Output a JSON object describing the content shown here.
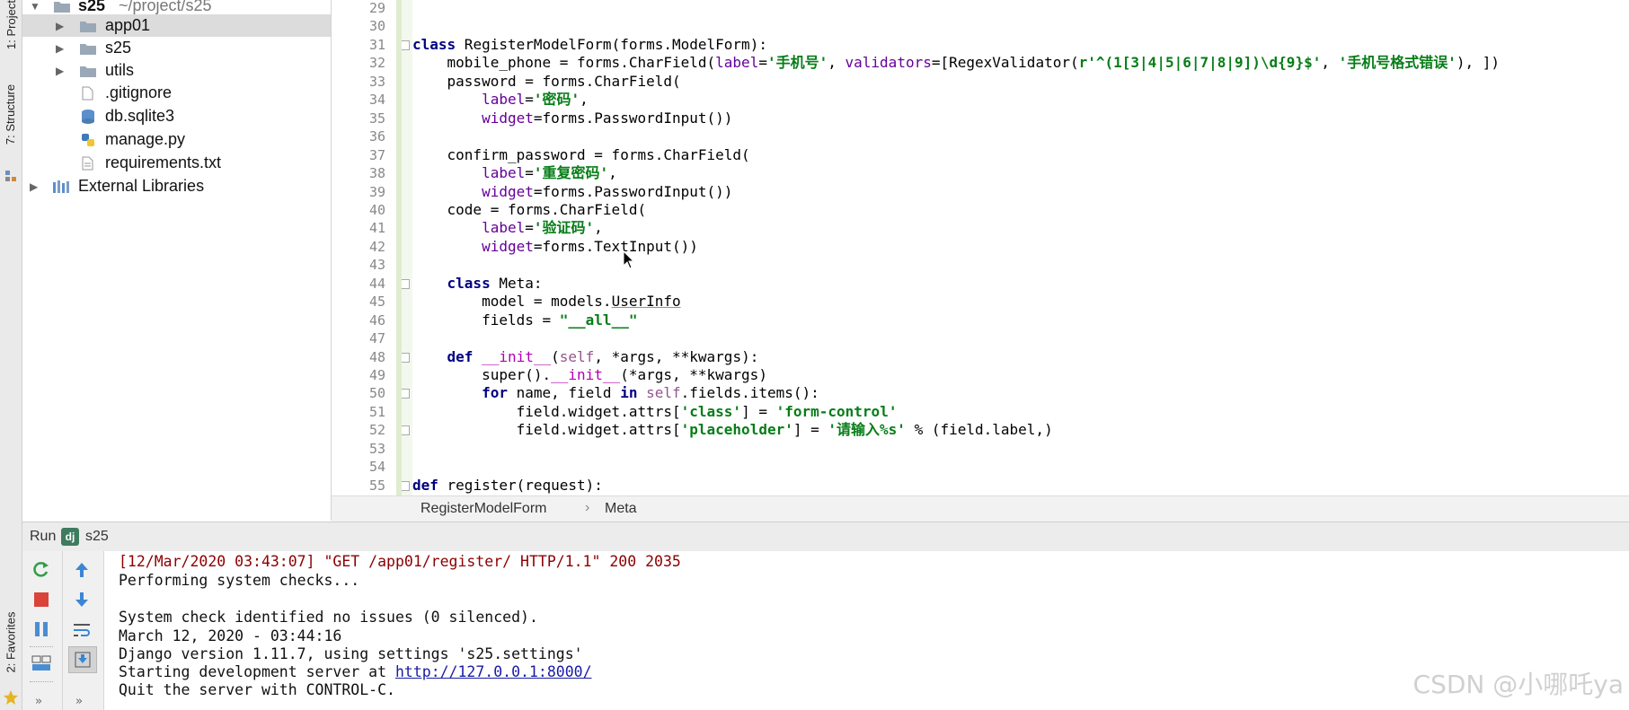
{
  "tool_windows": {
    "project_tab": "1: Project",
    "structure_tab": "7: Structure",
    "favorites_tab": "2: Favorites"
  },
  "project_tree": {
    "root_label": "s25",
    "root_path": "~/project/s25",
    "items": [
      {
        "label": "app01",
        "type": "folder",
        "selected": true
      },
      {
        "label": "s25",
        "type": "folder"
      },
      {
        "label": "utils",
        "type": "folder"
      },
      {
        "label": ".gitignore",
        "type": "file"
      },
      {
        "label": "db.sqlite3",
        "type": "database"
      },
      {
        "label": "manage.py",
        "type": "python"
      },
      {
        "label": "requirements.txt",
        "type": "text"
      },
      {
        "label": "External Libraries",
        "type": "libraries"
      }
    ]
  },
  "editor": {
    "line_numbers": [
      "29",
      "30",
      "31",
      "32",
      "33",
      "34",
      "35",
      "36",
      "37",
      "38",
      "39",
      "40",
      "41",
      "42",
      "43",
      "44",
      "45",
      "46",
      "47",
      "48",
      "49",
      "50",
      "51",
      "52",
      "53",
      "54",
      "55"
    ],
    "current_line": "45",
    "code_lines": [
      "",
      "",
      "class RegisterModelForm(forms.ModelForm):",
      "    mobile_phone = forms.CharField(label='手机号', validators=[RegexValidator(r'^(1[3|4|5|6|7|8|9])\\d{9}$', '手机号格式错误'), ])",
      "    password = forms.CharField(",
      "        label='密码',",
      "        widget=forms.PasswordInput())",
      "",
      "    confirm_password = forms.CharField(",
      "        label='重复密码',",
      "        widget=forms.PasswordInput())",
      "    code = forms.CharField(",
      "        label='验证码',",
      "        widget=forms.TextInput())",
      "",
      "    class Meta:",
      "        model = models.UserInfo",
      "        fields = \"__all__\"",
      "",
      "    def __init__(self, *args, **kwargs):",
      "        super().__init__(*args, **kwargs)",
      "        for name, field in self.fields.items():",
      "            field.widget.attrs['class'] = 'form-control'",
      "            field.widget.attrs['placeholder'] = '请输入%s' % (field.label,)",
      "",
      "",
      "def register(request):"
    ],
    "breadcrumb": [
      "RegisterModelForm",
      "Meta"
    ]
  },
  "run_panel": {
    "title": "Run",
    "config_name": "s25",
    "buttons": [
      "rerun-icon",
      "stop-icon",
      "pause-icon",
      "layout-icon",
      "up-icon",
      "down-icon",
      "soft-wrap-icon",
      "scroll-to-end-icon"
    ],
    "console_lines": [
      {
        "text": "[12/Mar/2020 03:43:07] \"GET /app01/register/ HTTP/1.1\" 200 2035",
        "style": "error"
      },
      {
        "text": "Performing system checks...",
        "style": "normal"
      },
      {
        "text": "",
        "style": "normal"
      },
      {
        "text": "System check identified no issues (0 silenced).",
        "style": "normal"
      },
      {
        "text": "March 12, 2020 - 03:44:16",
        "style": "normal"
      },
      {
        "text": "Django version 1.11.7, using settings 's25.settings'",
        "style": "normal"
      },
      {
        "text": "Starting development server at ",
        "style": "normal",
        "link": "http://127.0.0.1:8000/"
      },
      {
        "text": "Quit the server with CONTROL-C.",
        "style": "normal"
      }
    ]
  },
  "watermark": "CSDN @小哪吒ya",
  "colors": {
    "keyword": "#000080",
    "string": "#067d17",
    "self": "#94558d",
    "dunder": "#b200b2",
    "console_error": "#8b0000",
    "link": "#1a1aa6"
  }
}
